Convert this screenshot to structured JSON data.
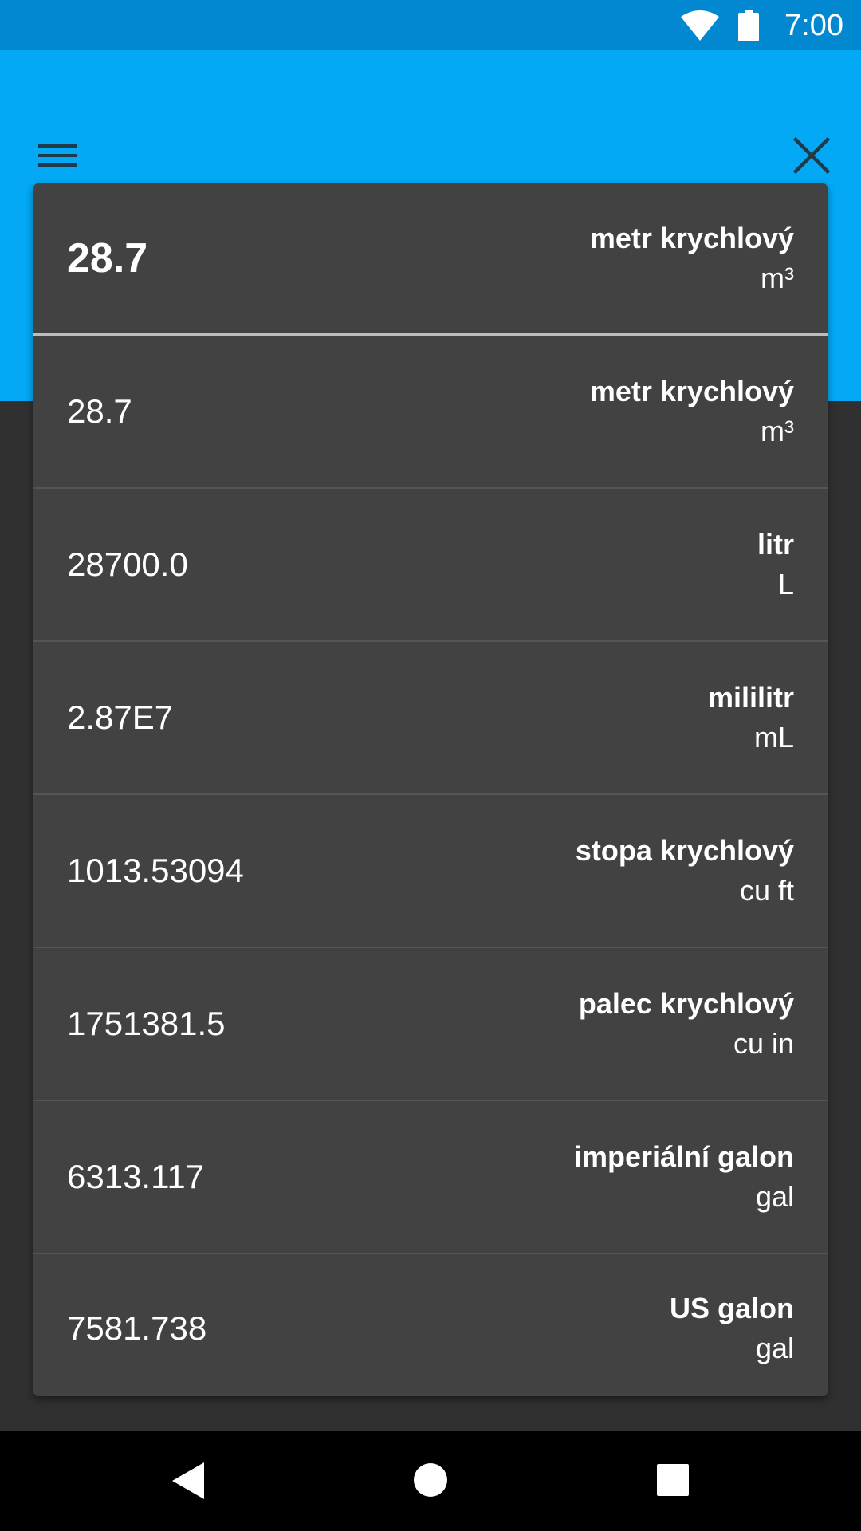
{
  "status_bar": {
    "time": "7:00"
  },
  "conversions": {
    "source": {
      "value": "28.7",
      "unit_name": "metr krychlový",
      "unit_symbol": "m³"
    },
    "rows": [
      {
        "value": "28.7",
        "unit_name": "metr krychlový",
        "unit_symbol": "m³"
      },
      {
        "value": "28700.0",
        "unit_name": "litr",
        "unit_symbol": "L"
      },
      {
        "value": "2.87E7",
        "unit_name": "mililitr",
        "unit_symbol": "mL"
      },
      {
        "value": "1013.53094",
        "unit_name": "stopa krychlový",
        "unit_symbol": "cu ft"
      },
      {
        "value": "1751381.5",
        "unit_name": "palec krychlový",
        "unit_symbol": "cu in"
      },
      {
        "value": "6313.117",
        "unit_name": "imperiální galon",
        "unit_symbol": "gal"
      },
      {
        "value": "7581.738",
        "unit_name": "US galon",
        "unit_symbol": "gal"
      }
    ]
  },
  "icons": {
    "menu": "menu-icon",
    "close": "close-icon",
    "wifi": "wifi-icon",
    "battery": "battery-icon",
    "back": "back-icon",
    "home": "home-icon",
    "recent": "recent-apps-icon"
  },
  "colors": {
    "status_bar": "#0288D1",
    "app_bar": "#03A9F4",
    "background": "#303030",
    "card": "#424242"
  }
}
